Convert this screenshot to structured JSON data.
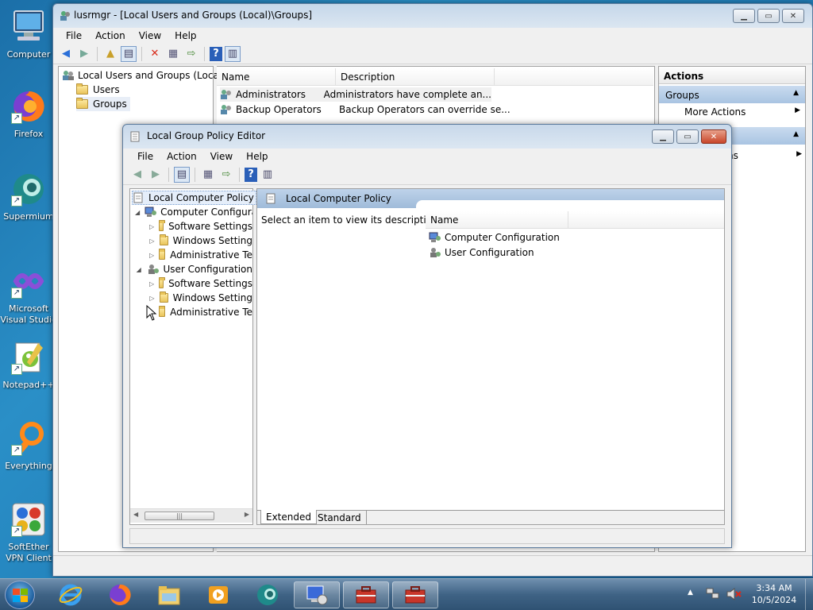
{
  "desktop": {
    "icons": [
      {
        "label": "Computer"
      },
      {
        "label": "Firefox"
      },
      {
        "label": "Supermium"
      },
      {
        "label": "Microsoft Visual Studio"
      },
      {
        "label": "Notepad++"
      },
      {
        "label": "Everything"
      },
      {
        "label": "SoftEther VPN Client Manager"
      }
    ]
  },
  "lusrmgr": {
    "title": "lusrmgr - [Local Users and Groups (Local)\\Groups]",
    "menu": [
      "File",
      "Action",
      "View",
      "Help"
    ],
    "tree": {
      "root": "Local Users and Groups (Local)",
      "items": [
        "Users",
        "Groups"
      ]
    },
    "columns": {
      "name": "Name",
      "description": "Description"
    },
    "rows": [
      {
        "name": "Administrators",
        "description": "Administrators have complete an..."
      },
      {
        "name": "Backup Operators",
        "description": "Backup Operators can override se..."
      }
    ],
    "actions": {
      "header": "Actions",
      "section": "Groups",
      "more": "More Actions",
      "second_partial": "ns"
    }
  },
  "gpedit": {
    "title": "Local Group Policy Editor",
    "menu": [
      "File",
      "Action",
      "View",
      "Help"
    ],
    "tree": {
      "root": "Local Computer Policy",
      "computer_config": "Computer Configura",
      "computer_children": [
        "Software Settings",
        "Windows Setting",
        "Administrative Te"
      ],
      "user_config": "User Configuration",
      "user_children": [
        "Software Settings",
        "Windows Setting",
        "Administrative Te"
      ]
    },
    "content": {
      "header": "Local Computer Policy",
      "description": "Select an item to view its description.",
      "column_name": "Name",
      "items": [
        "Computer Configuration",
        "User Configuration"
      ]
    },
    "tabs": {
      "extended": "Extended",
      "standard": "Standard"
    }
  },
  "taskbar": {
    "time": "3:34 AM",
    "date": "10/5/2024"
  }
}
